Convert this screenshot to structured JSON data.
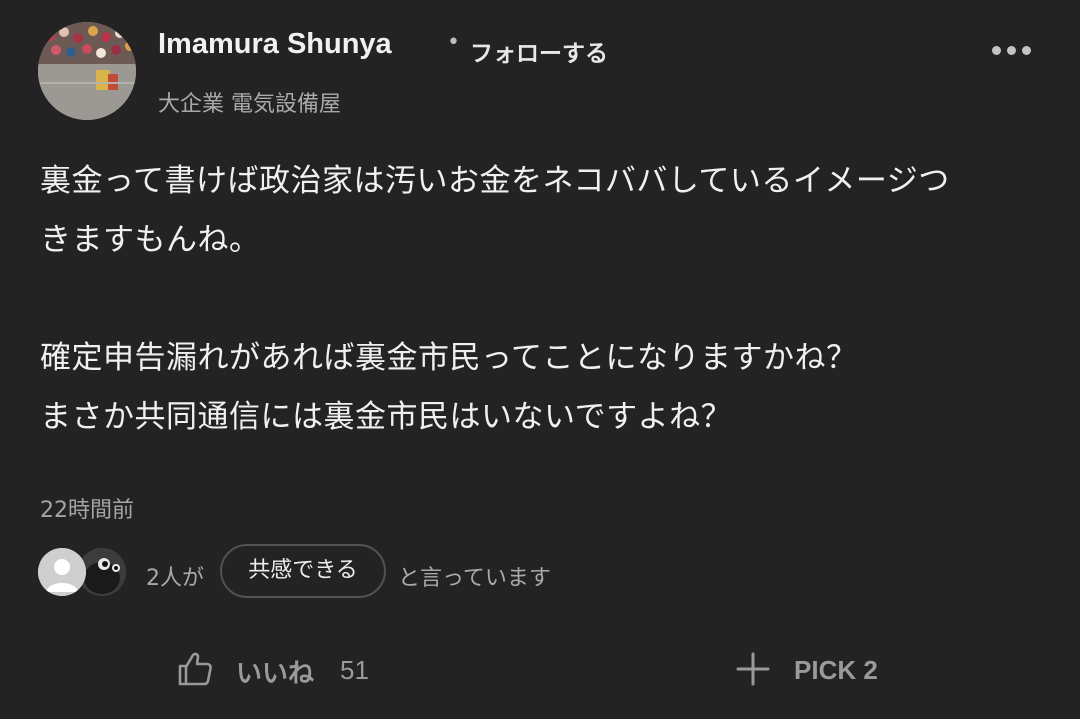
{
  "author": {
    "name": "Imamura Shunya",
    "separator": "•",
    "follow_label": "フォローする",
    "profile": "大企業 電気設備屋",
    "avatar_icon": "profile-photo-icon"
  },
  "menu": {
    "icon": "more-horizontal-icon"
  },
  "comment": {
    "lines": [
      "裏金って書けば政治家は汚いお金をネコババしているイメージつ",
      "きますもんね。",
      "",
      "確定申告漏れがあれば裏金市民ってことになりますかね？",
      "まさか共同通信には裏金市民はいないですよね？"
    ],
    "posted": "22時間前"
  },
  "reactions": {
    "count_text": "2人が",
    "button_label": "共感できる",
    "suffix_text": "と言っています",
    "avatar_icons": [
      "default-user-icon",
      "bird-avatar-icon"
    ]
  },
  "actions": {
    "like_label": "いいね",
    "like_count": "51",
    "like_icon": "thumbs-up-icon",
    "pick_label": "PICK 2",
    "pick_icon": "plus-icon"
  },
  "colors": {
    "background": "#232323",
    "text": "#f0f0f0",
    "muted": "#a9a9a9",
    "action": "#9a9a9a"
  }
}
